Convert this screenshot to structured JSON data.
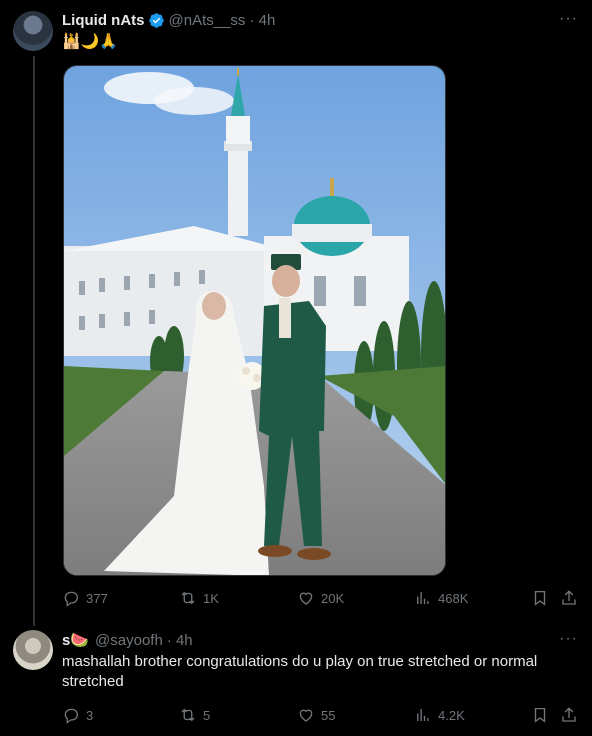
{
  "post": {
    "author_name": "Liquid nAts",
    "handle": "@nAts__ss",
    "time": "· 4h",
    "content": "🕌🌙🙏",
    "stats": {
      "replies": "377",
      "reposts": "1K",
      "likes": "20K",
      "views": "468K"
    }
  },
  "reply": {
    "author_name": "s🍉",
    "handle": "@sayoofh",
    "time": "· 4h",
    "content": "mashallah brother congratulations do u play on true stretched or normal stretched",
    "stats": {
      "replies": "3",
      "reposts": "5",
      "likes": "55",
      "views": "4.2K"
    }
  },
  "more_label": "···",
  "colors": {
    "background": "#000000",
    "text": "#e7e9ea",
    "muted": "#71767b",
    "verified": "#1d9bf0"
  }
}
